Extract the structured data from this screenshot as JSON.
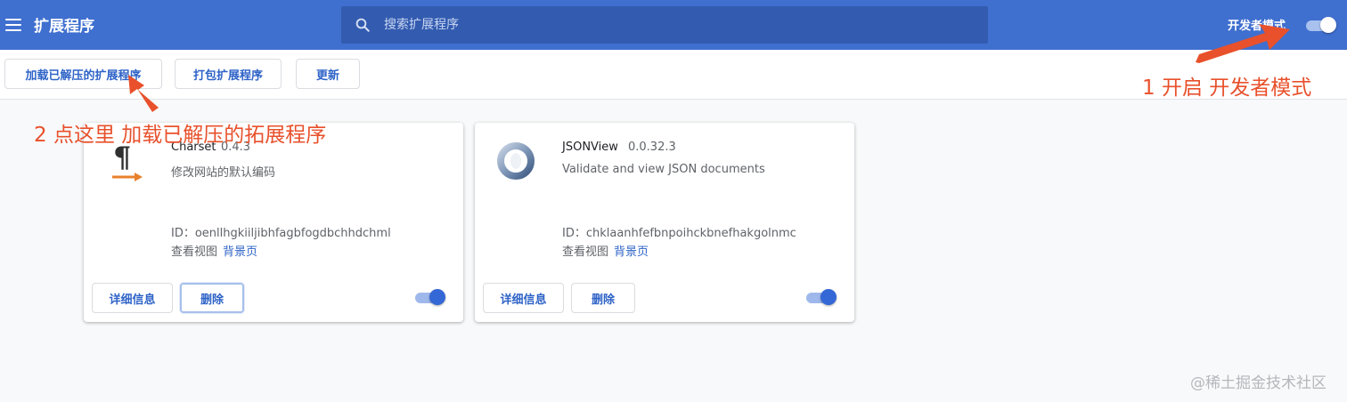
{
  "header": {
    "title": "扩展程序",
    "search_placeholder": "搜索扩展程序",
    "dev_mode_label": "开发者模式",
    "dev_mode_on": true
  },
  "toolbar": {
    "load_unpacked_label": "加载已解压的扩展程序",
    "pack_label": "打包扩展程序",
    "update_label": "更新"
  },
  "extensions": [
    {
      "name": "Charset",
      "version": "0.4.3",
      "description": "修改网站的默认编码",
      "id_text": "ID：oenllhgkiiljibhfagbfogdbchhdchml",
      "views_label": "查看视图",
      "views_link": "背景页",
      "details_label": "详细信息",
      "remove_label": "删除",
      "enabled": true
    },
    {
      "name": "JSONView",
      "version": "0.0.32.3",
      "description": "Validate and view JSON documents",
      "id_text": "ID：chklaanhfefbnpoihckbnefhakgolnmc",
      "views_label": "查看视图",
      "views_link": "背景页",
      "details_label": "详细信息",
      "remove_label": "删除",
      "enabled": true
    }
  ],
  "annotations": {
    "step1": "1 开启 开发者模式",
    "step2": "2 点这里 加载已解压的拓展程序"
  },
  "watermark": "@稀土掘金技术社区",
  "colors": {
    "header_bg": "#3f6fcf",
    "accent": "#2e63c7",
    "annotation": "#e8512c"
  }
}
